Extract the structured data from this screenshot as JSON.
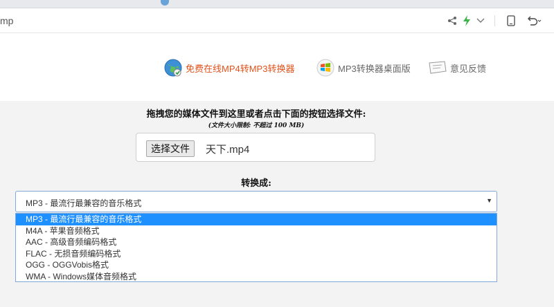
{
  "browser": {
    "url_fragment": "mp"
  },
  "nav": {
    "items": [
      {
        "label": "免费在线MP4转MP3转换器"
      },
      {
        "label": "MP3转换器桌面版"
      },
      {
        "label": "意见反馈"
      }
    ]
  },
  "upload": {
    "instruction": "拖拽您的媒体文件到这里或者点击下面的按钮选择文件:",
    "size_limit": "(文件大小限制: 不超过 100 MB)",
    "choose_button": "选择文件",
    "file_name": "天下.mp4"
  },
  "convert": {
    "label": "转换成:",
    "selected": "MP3 - 最流行最兼容的音乐格式",
    "options": [
      "MP3 - 最流行最兼容的音乐格式",
      "M4A - 苹果音频格式",
      "AAC - 高级音频编码格式",
      "FLAC - 无损音频编码格式",
      "OGG - OGGVobis格式",
      "WMA - Windows媒体音频格式"
    ],
    "highlighted_index": 0
  },
  "colors": {
    "accent_orange": "#e0521b",
    "selection_blue": "#1e90ff",
    "select_border": "#7fa7d8"
  }
}
